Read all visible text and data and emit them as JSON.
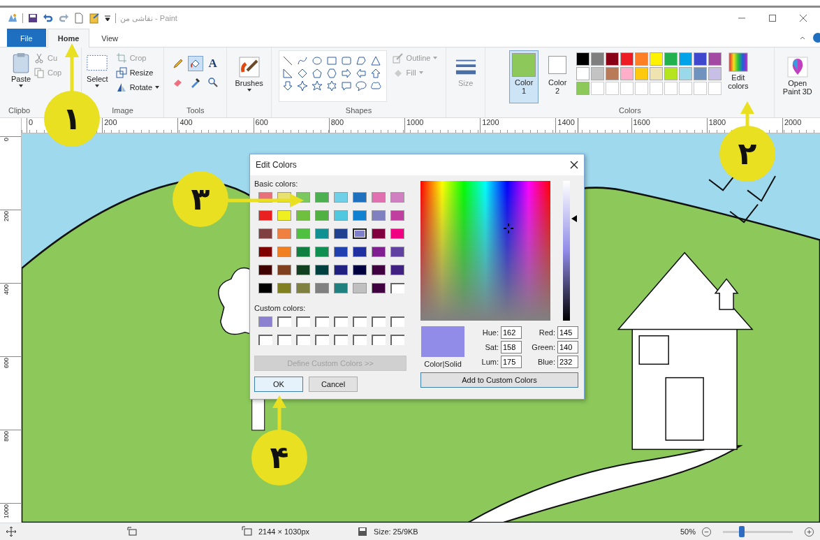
{
  "title_bar": {
    "title": "نقاشی من - Paint"
  },
  "tabs": [
    {
      "label": "File",
      "kind": "file",
      "selected": false
    },
    {
      "label": "Home",
      "kind": "tab",
      "selected": true
    },
    {
      "label": "View",
      "kind": "tab",
      "selected": false
    }
  ],
  "ribbon": {
    "clipboard": {
      "label": "Clipbo",
      "paste": "Paste",
      "cut": "Cu",
      "copy": "Cop"
    },
    "image": {
      "label": "Image",
      "select": "Select",
      "crop": "Crop",
      "resize": "Resize",
      "rotate": "Rotate"
    },
    "tools": {
      "label": "Tools",
      "items": [
        {
          "kind": "pencil",
          "selected": false
        },
        {
          "kind": "fill",
          "selected": true
        },
        {
          "kind": "text",
          "glyph": "A",
          "selected": false
        },
        {
          "kind": "eraser",
          "selected": false
        },
        {
          "kind": "picker",
          "selected": false
        },
        {
          "kind": "magnifier",
          "selected": false
        }
      ]
    },
    "brushes": "Brushes",
    "shapes": {
      "label": "Shapes",
      "outline": "Outline",
      "fill": "Fill"
    },
    "size": "Size",
    "color1": {
      "label": "Color",
      "number": "1",
      "color": "#8cc85a",
      "selected": true
    },
    "color2": {
      "label": "Color",
      "number": "2",
      "color": "#ffffff",
      "selected": false
    },
    "palette": [
      {
        "kind": "swatch",
        "color": "#000000"
      },
      {
        "kind": "swatch",
        "color": "#7f7f7f"
      },
      {
        "kind": "swatch",
        "color": "#880015"
      },
      {
        "kind": "swatch",
        "color": "#ed1c24"
      },
      {
        "kind": "swatch",
        "color": "#ff7f27"
      },
      {
        "kind": "swatch",
        "color": "#fff200"
      },
      {
        "kind": "swatch",
        "color": "#22b14c"
      },
      {
        "kind": "swatch",
        "color": "#00a2e8"
      },
      {
        "kind": "swatch",
        "color": "#3f48cc"
      },
      {
        "kind": "swatch",
        "color": "#a349a4"
      },
      {
        "kind": "swatch",
        "color": "#ffffff"
      },
      {
        "kind": "swatch",
        "color": "#c3c3c3"
      },
      {
        "kind": "swatch",
        "color": "#b97a57"
      },
      {
        "kind": "swatch",
        "color": "#ffaec9"
      },
      {
        "kind": "swatch",
        "color": "#ffc90e"
      },
      {
        "kind": "swatch",
        "color": "#efe4b0"
      },
      {
        "kind": "swatch",
        "color": "#b5e61d"
      },
      {
        "kind": "swatch",
        "color": "#99d9ea"
      },
      {
        "kind": "swatch",
        "color": "#7092be"
      },
      {
        "kind": "swatch",
        "color": "#c8bfe7"
      },
      {
        "kind": "swatch",
        "color": "#8cc85a"
      },
      {
        "kind": "empty"
      },
      {
        "kind": "empty"
      },
      {
        "kind": "empty"
      },
      {
        "kind": "empty"
      },
      {
        "kind": "empty"
      },
      {
        "kind": "empty"
      },
      {
        "kind": "empty"
      },
      {
        "kind": "empty"
      },
      {
        "kind": "empty"
      }
    ],
    "colors_label": "Colors",
    "edit_colors": {
      "line1": "Edit",
      "line2": "colors"
    },
    "paint3d": {
      "line1": "Open",
      "line2": "Paint 3D"
    }
  },
  "ruler": {
    "horizontal": [
      "0",
      "200",
      "400",
      "600",
      "800",
      "1000",
      "1200",
      "1400",
      "1600",
      "1800",
      "2000"
    ],
    "vertical": [
      "0",
      "200",
      "400",
      "600",
      "800",
      "1000"
    ]
  },
  "dialog": {
    "title": "Edit Colors",
    "basic_label": "Basic colors:",
    "basic_colors": [
      {
        "kind": "swatch",
        "color": "#e8707a",
        "selected": false
      },
      {
        "kind": "swatch",
        "color": "#e8e070",
        "selected": false
      },
      {
        "kind": "swatch",
        "color": "#7cc860",
        "selected": false
      },
      {
        "kind": "swatch",
        "color": "#4cb050",
        "selected": false
      },
      {
        "kind": "swatch",
        "color": "#70d0e8",
        "selected": false
      },
      {
        "kind": "swatch",
        "color": "#2070c0",
        "selected": false
      },
      {
        "kind": "swatch",
        "color": "#e070b0",
        "selected": false
      },
      {
        "kind": "swatch",
        "color": "#d080c0",
        "selected": false
      },
      {
        "kind": "swatch",
        "color": "#e82020",
        "selected": false
      },
      {
        "kind": "swatch",
        "color": "#f0f020",
        "selected": false
      },
      {
        "kind": "swatch",
        "color": "#70c040",
        "selected": false
      },
      {
        "kind": "swatch",
        "color": "#50b040",
        "selected": false
      },
      {
        "kind": "swatch",
        "color": "#50c8e0",
        "selected": false
      },
      {
        "kind": "swatch",
        "color": "#1080d0",
        "selected": false
      },
      {
        "kind": "swatch",
        "color": "#8080c0",
        "selected": false
      },
      {
        "kind": "swatch",
        "color": "#c040a0",
        "selected": false
      },
      {
        "kind": "swatch",
        "color": "#804040",
        "selected": false
      },
      {
        "kind": "swatch",
        "color": "#f08040",
        "selected": false
      },
      {
        "kind": "swatch",
        "color": "#50c040",
        "selected": false
      },
      {
        "kind": "swatch",
        "color": "#109090",
        "selected": false
      },
      {
        "kind": "swatch",
        "color": "#204090",
        "selected": false
      },
      {
        "kind": "swatch",
        "color": "#8080c8",
        "selected": true
      },
      {
        "kind": "swatch",
        "color": "#800040",
        "selected": false
      },
      {
        "kind": "swatch",
        "color": "#f00080",
        "selected": false
      },
      {
        "kind": "swatch",
        "color": "#800000",
        "selected": false
      },
      {
        "kind": "swatch",
        "color": "#f08020",
        "selected": false
      },
      {
        "kind": "swatch",
        "color": "#108040",
        "selected": false
      },
      {
        "kind": "swatch",
        "color": "#109050",
        "selected": false
      },
      {
        "kind": "swatch",
        "color": "#2040b0",
        "selected": false
      },
      {
        "kind": "swatch",
        "color": "#2030a0",
        "selected": false
      },
      {
        "kind": "swatch",
        "color": "#802090",
        "selected": false
      },
      {
        "kind": "swatch",
        "color": "#6040a0",
        "selected": false
      },
      {
        "kind": "swatch",
        "color": "#400000",
        "selected": false
      },
      {
        "kind": "swatch",
        "color": "#804020",
        "selected": false
      },
      {
        "kind": "swatch",
        "color": "#104020",
        "selected": false
      },
      {
        "kind": "swatch",
        "color": "#004040",
        "selected": false
      },
      {
        "kind": "swatch",
        "color": "#202080",
        "selected": false
      },
      {
        "kind": "swatch",
        "color": "#000040",
        "selected": false
      },
      {
        "kind": "swatch",
        "color": "#400040",
        "selected": false
      },
      {
        "kind": "swatch",
        "color": "#402080",
        "selected": false
      },
      {
        "kind": "swatch",
        "color": "#000000",
        "selected": false
      },
      {
        "kind": "swatch",
        "color": "#808020",
        "selected": false
      },
      {
        "kind": "swatch",
        "color": "#808040",
        "selected": false
      },
      {
        "kind": "swatch",
        "color": "#808080",
        "selected": false
      },
      {
        "kind": "swatch",
        "color": "#208080",
        "selected": false
      },
      {
        "kind": "swatch",
        "color": "#c0c0c0",
        "selected": false
      },
      {
        "kind": "swatch",
        "color": "#400040",
        "selected": false
      },
      {
        "kind": "empty",
        "selected": false
      }
    ],
    "custom_label": "Custom colors:",
    "custom_colors": [
      {
        "kind": "swatch",
        "color": "#8c80d0"
      },
      {
        "kind": "empty"
      },
      {
        "kind": "empty"
      },
      {
        "kind": "empty"
      },
      {
        "kind": "empty"
      },
      {
        "kind": "empty"
      },
      {
        "kind": "empty"
      },
      {
        "kind": "empty"
      },
      {
        "kind": "empty"
      },
      {
        "kind": "empty"
      },
      {
        "kind": "empty"
      },
      {
        "kind": "empty"
      },
      {
        "kind": "empty"
      },
      {
        "kind": "empty"
      },
      {
        "kind": "empty"
      },
      {
        "kind": "empty"
      }
    ],
    "define_button": {
      "label": "Define Custom Colors >>",
      "disabled": true
    },
    "ok_button": "OK",
    "cancel_button": "Cancel",
    "luminance": {
      "level": 0.73
    },
    "preview": {
      "color": "#918ce8",
      "label": "Color|Solid"
    },
    "fields_left": [
      {
        "label": "Hue:",
        "value": "162"
      },
      {
        "label": "Sat:",
        "value": "158"
      },
      {
        "label": "Lum:",
        "value": "175"
      }
    ],
    "fields_right": [
      {
        "label": "Red:",
        "value": "145"
      },
      {
        "label": "Green:",
        "value": "140"
      },
      {
        "label": "Blue:",
        "value": "232"
      }
    ],
    "add_button": "Add to Custom Colors"
  },
  "status_bar": {
    "dimensions": "2144 × 1030px",
    "size": "Size: 25/9KB",
    "zoom": "50%",
    "zoom_slider": {
      "level": 0.27
    }
  },
  "callouts": [
    {
      "number": "۱"
    },
    {
      "number": "۲"
    },
    {
      "number": "۳"
    },
    {
      "number": "۴"
    }
  ]
}
